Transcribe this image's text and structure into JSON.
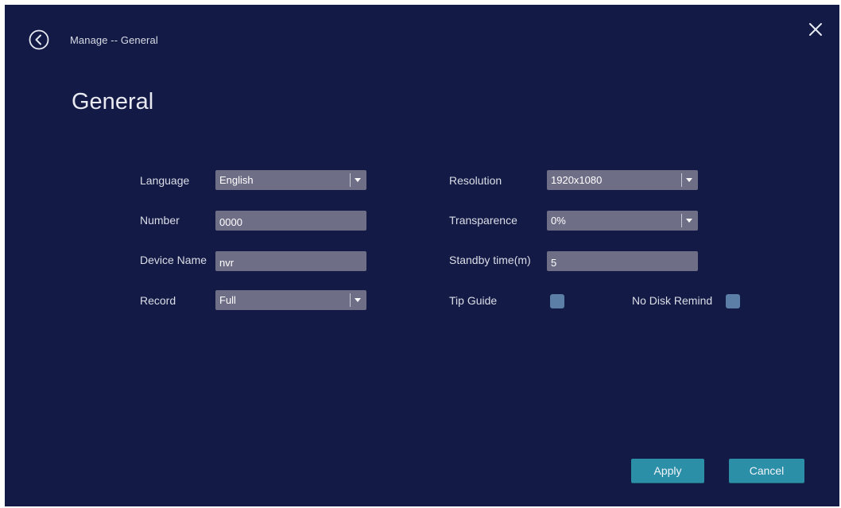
{
  "header": {
    "breadcrumb": "Manage -- General",
    "back_icon": "back-circle-icon",
    "close_icon": "close-icon"
  },
  "page": {
    "title": "General"
  },
  "form": {
    "language": {
      "label": "Language",
      "value": "English"
    },
    "number": {
      "label": "Number",
      "value": "0000"
    },
    "device_name": {
      "label": "Device Name",
      "value": "nvr"
    },
    "record": {
      "label": "Record",
      "value": "Full"
    },
    "resolution": {
      "label": "Resolution",
      "value": "1920x1080"
    },
    "transparence": {
      "label": "Transparence",
      "value": "0%"
    },
    "standby_time": {
      "label": "Standby time(m)",
      "value": "5"
    },
    "tip_guide": {
      "label": "Tip Guide"
    },
    "no_disk_remind": {
      "label": "No Disk Remind"
    }
  },
  "actions": {
    "apply_label": "Apply",
    "cancel_label": "Cancel"
  },
  "colors": {
    "background": "#121a45",
    "field": "#6f6e87",
    "checkbox": "#5b7fa6",
    "button": "#2b8fa8"
  }
}
